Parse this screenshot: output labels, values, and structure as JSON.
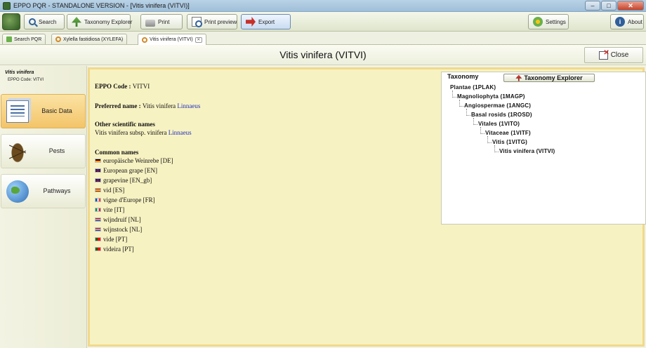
{
  "window": {
    "title": "EPPO PQR - STANDALONE VERSION - [Vitis vinifera (VITVI)]",
    "controls": {
      "minimize": "–",
      "maximize": "□",
      "close": "✕"
    }
  },
  "toolbar": {
    "search": "Search",
    "taxonomy_explorer": "Taxonomy Explorer",
    "print": "Print",
    "print_preview": "Print preview",
    "export": "Export",
    "settings": "Settings",
    "about": "About"
  },
  "tabs": [
    {
      "label": "Search PQR"
    },
    {
      "label": "Xylella fastidiosa (XYLEFA)"
    },
    {
      "label": "Vitis vinifera (VITVI)"
    }
  ],
  "header": {
    "title": "Vitis vinifera (VITVI)",
    "close_label": "Close"
  },
  "sidebar": {
    "species": "Vitis vinifera",
    "code": "EPPO Code: VITVI",
    "items": [
      {
        "label": "Basic Data"
      },
      {
        "label": "Pests"
      },
      {
        "label": "Pathways"
      }
    ]
  },
  "details": {
    "eppo_code_label": "EPPO Code :",
    "eppo_code": "VITVI",
    "preferred_label": "Preferred name :",
    "preferred_name": "Vitis vinifera",
    "preferred_author": "Linnaeus",
    "other_label": "Other scientific names",
    "other_name": "Vitis vinifera subsp. vinifera",
    "other_author": "Linnaeus",
    "common_label": "Common names",
    "common_names": [
      {
        "name": "europäische Weinrebe [DE]"
      },
      {
        "name": "European grape [EN]"
      },
      {
        "name": "grapevine [EN_gb]"
      },
      {
        "name": "vid [ES]"
      },
      {
        "name": "vigne d'Europe [FR]"
      },
      {
        "name": "vite [IT]"
      },
      {
        "name": "wijndruif [NL]"
      },
      {
        "name": "wijnstock [NL]"
      },
      {
        "name": "vide [PT]"
      },
      {
        "name": "videira [PT]"
      }
    ]
  },
  "taxonomy": {
    "title": "Taxonomy",
    "button": "Taxonomy Explorer",
    "nodes": [
      {
        "label": "Plantae (1PLAK)"
      },
      {
        "label": "Magnoliophyta (1MAGP)"
      },
      {
        "label": "Angiospermae (1ANGC)"
      },
      {
        "label": "Basal rosids (1ROSD)"
      },
      {
        "label": "Vitales (1VITO)"
      },
      {
        "label": "Vitaceae (1VITF)"
      },
      {
        "label": "Vitis (1VITG)"
      },
      {
        "label": "Vitis vinifera (VITVI)"
      }
    ]
  },
  "flag_colors": {
    "DE": [
      "#000000",
      "#dd0000",
      "#ffce00"
    ],
    "EN": [
      "#012169",
      "#c8102e",
      "#ffffff"
    ],
    "ES": [
      "#aa151b",
      "#f1bf00",
      "#aa151b"
    ],
    "FR": [
      "#0055a4",
      "#ffffff",
      "#ef4135"
    ],
    "IT": [
      "#009246",
      "#ffffff",
      "#ce2b37"
    ],
    "NL": [
      "#ae1c28",
      "#ffffff",
      "#21468b"
    ],
    "PT": [
      "#006600",
      "#ff0000",
      "#ff0000"
    ]
  }
}
